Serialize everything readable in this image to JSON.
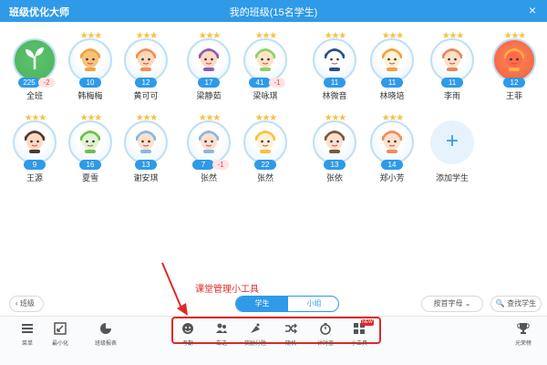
{
  "titlebar": {
    "app_name": "班级优化大师",
    "class_title": "我的班级(15名学生)",
    "close_glyph": "×"
  },
  "students": [
    {
      "name": "全班",
      "score": "225",
      "minus": "-2",
      "avatar": "sprout",
      "stars": false
    },
    {
      "name": "韩梅梅",
      "score": "10",
      "minus": "",
      "avatar": "fox",
      "stars": true
    },
    {
      "name": "黄可可",
      "score": "12",
      "minus": "",
      "avatar": "girl-orange",
      "stars": true
    },
    {
      "name": "梁静茹",
      "score": "17",
      "minus": "",
      "avatar": "girl-glasses",
      "stars": true
    },
    {
      "name": "梁咏琪",
      "score": "41",
      "minus": "-1",
      "avatar": "fairy",
      "stars": true
    },
    {
      "name": "林微音",
      "score": "11",
      "minus": "",
      "avatar": "penguin",
      "stars": true
    },
    {
      "name": "林晓培",
      "score": "11",
      "minus": "",
      "avatar": "tiger",
      "stars": true
    },
    {
      "name": "李雨",
      "score": "11",
      "minus": "",
      "avatar": "fox-boy",
      "stars": true
    },
    {
      "name": "王菲",
      "score": "12",
      "minus": "",
      "avatar": "chick",
      "stars": true
    },
    {
      "name": "王源",
      "score": "9",
      "minus": "",
      "avatar": "boy",
      "stars": true
    },
    {
      "name": "夏雪",
      "score": "16",
      "minus": "",
      "avatar": "frog",
      "stars": true
    },
    {
      "name": "谢安琪",
      "score": "13",
      "minus": "",
      "avatar": "girl-blue",
      "stars": true
    },
    {
      "name": "张然",
      "score": "7",
      "minus": "-1",
      "avatar": "boy-blue",
      "stars": true
    },
    {
      "name": "张然",
      "score": "22",
      "minus": "",
      "avatar": "tiger-yellow",
      "stars": true
    },
    {
      "name": "张依",
      "score": "13",
      "minus": "",
      "avatar": "girl-bow",
      "stars": true
    },
    {
      "name": "郑小芳",
      "score": "14",
      "minus": "",
      "avatar": "girl-pink",
      "stars": true
    }
  ],
  "add_student": {
    "label": "添加学生",
    "icon": "plus-icon",
    "glyph": "+"
  },
  "bottom": {
    "class_btn": "‹ 班级",
    "seg_students": "学生",
    "seg_groups": "小组",
    "sort_btn": "按首字母 ⌄",
    "find_btn": "🔍 查找学生"
  },
  "annotation": {
    "label": "课堂管理小工具"
  },
  "toolbar": {
    "left": [
      {
        "label": "菜单",
        "icon": "menu-icon"
      },
      {
        "label": "最小化",
        "icon": "minimize-icon"
      },
      {
        "label": "班级报表",
        "icon": "report-icon"
      }
    ],
    "center": [
      {
        "label": "考勤",
        "icon": "attendance-icon"
      },
      {
        "label": "车选",
        "icon": "pick-icon"
      },
      {
        "label": "奖励分胜",
        "icon": "reward-icon"
      },
      {
        "label": "随机",
        "icon": "random-icon"
      },
      {
        "label": "计时器",
        "icon": "timer-icon"
      },
      {
        "label": "小工具",
        "icon": "tools-icon"
      }
    ],
    "new_badge": "NEW",
    "right": [
      {
        "label": "光荣榜",
        "icon": "trophy-icon"
      }
    ]
  },
  "colors": {
    "primary": "#2f9ae8",
    "annotation_red": "#e02828",
    "minus_text": "#e24b4b",
    "star": "#f5c242"
  }
}
